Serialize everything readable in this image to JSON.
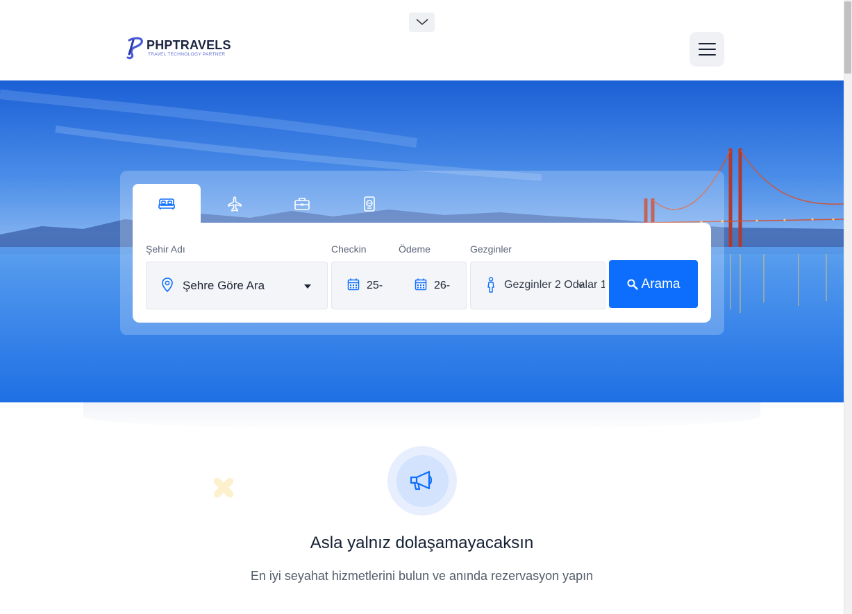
{
  "header": {
    "logo": {
      "name": "PHPTRAVELS",
      "tagline": "TRAVEL TECHNOLOGY PARTNER"
    },
    "collapse_icon": "chevron-down-icon",
    "menu_icon": "hamburger-menu-icon"
  },
  "search": {
    "tabs": [
      {
        "id": "hotels",
        "icon": "bed-icon",
        "active": true
      },
      {
        "id": "flights",
        "icon": "airplane-icon",
        "active": false
      },
      {
        "id": "tours",
        "icon": "briefcase-icon",
        "active": false
      },
      {
        "id": "visa",
        "icon": "passport-icon",
        "active": false
      }
    ],
    "city": {
      "label": "Şehir Adı",
      "value": "Şehre Göre Ara"
    },
    "checkin": {
      "label": "Checkin",
      "value": "25-"
    },
    "checkout": {
      "label": "Ödeme",
      "value": "26-"
    },
    "travellers": {
      "label": "Gezginler",
      "value": "Gezginler 2 Odalar 1"
    },
    "button_label": "Arama"
  },
  "feature": {
    "icon": "megaphone-icon",
    "title": "Asla yalnız dolaşamayacaksın",
    "subtitle": "En iyi seyahat hizmetlerini bulun ve anında rezervasyon yapın"
  },
  "colors": {
    "primary": "#0d6efd",
    "hero_blue": "#2f7be8",
    "deco_yellow": "#fdf0cc"
  }
}
